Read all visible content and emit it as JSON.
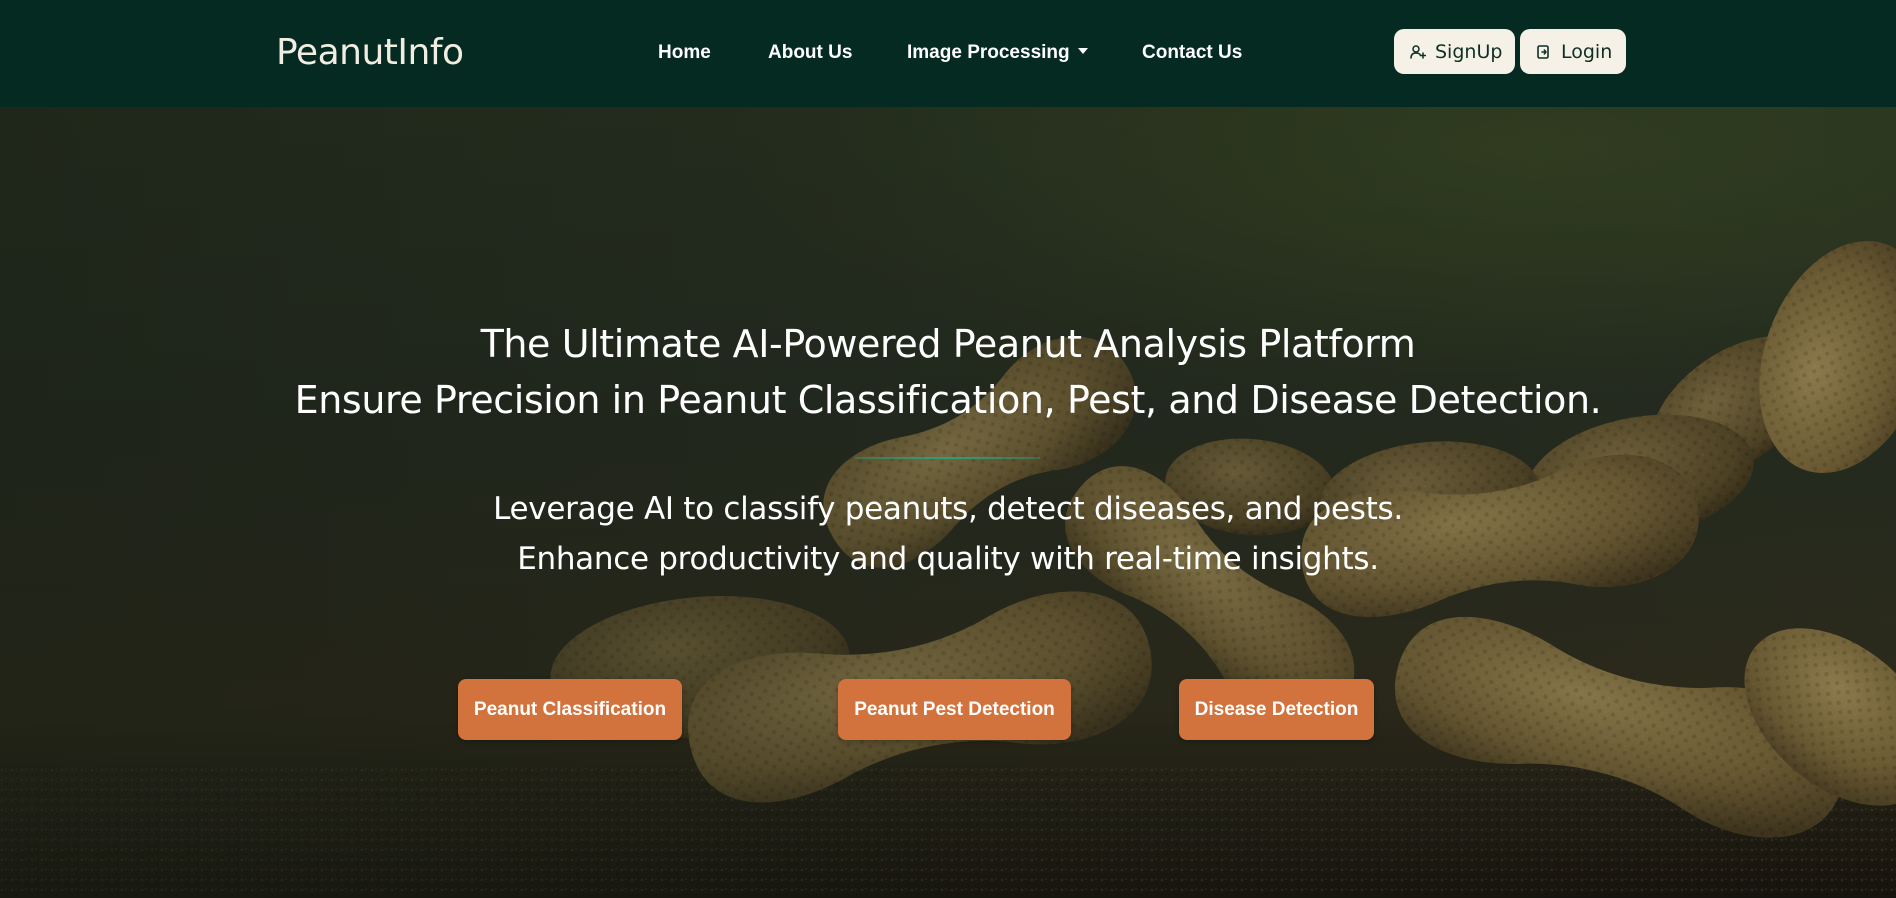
{
  "navbar": {
    "brand": "PeanutInfo",
    "links": [
      {
        "label": "Home"
      },
      {
        "label": "About Us"
      },
      {
        "label": "Image Processing",
        "icon": "caret-down-icon"
      },
      {
        "label": "Contact Us"
      }
    ],
    "signup": {
      "label": "SignUp",
      "icon": "user-plus-icon"
    },
    "login": {
      "label": "Login",
      "icon": "login-icon"
    }
  },
  "hero": {
    "headline_1": "The Ultimate AI-Powered Peanut Analysis Platform",
    "headline_2": "Ensure Precision in Peanut Classification, Pest, and Disease Detection.",
    "subline_1": "Leverage AI to classify peanuts, detect diseases, and pests.",
    "subline_2": "Enhance productivity and quality with real-time insights.",
    "buttons": [
      {
        "label": "Peanut Classification"
      },
      {
        "label": "Peanut Pest Detection"
      },
      {
        "label": "Disease Detection"
      }
    ],
    "background_image": "peanuts-photo"
  },
  "colors": {
    "navbar_bg": "#042a22",
    "auth_button_bg": "#f6f1e6",
    "cta_bg": "#d2723c",
    "divider": "#2f9e7a"
  }
}
